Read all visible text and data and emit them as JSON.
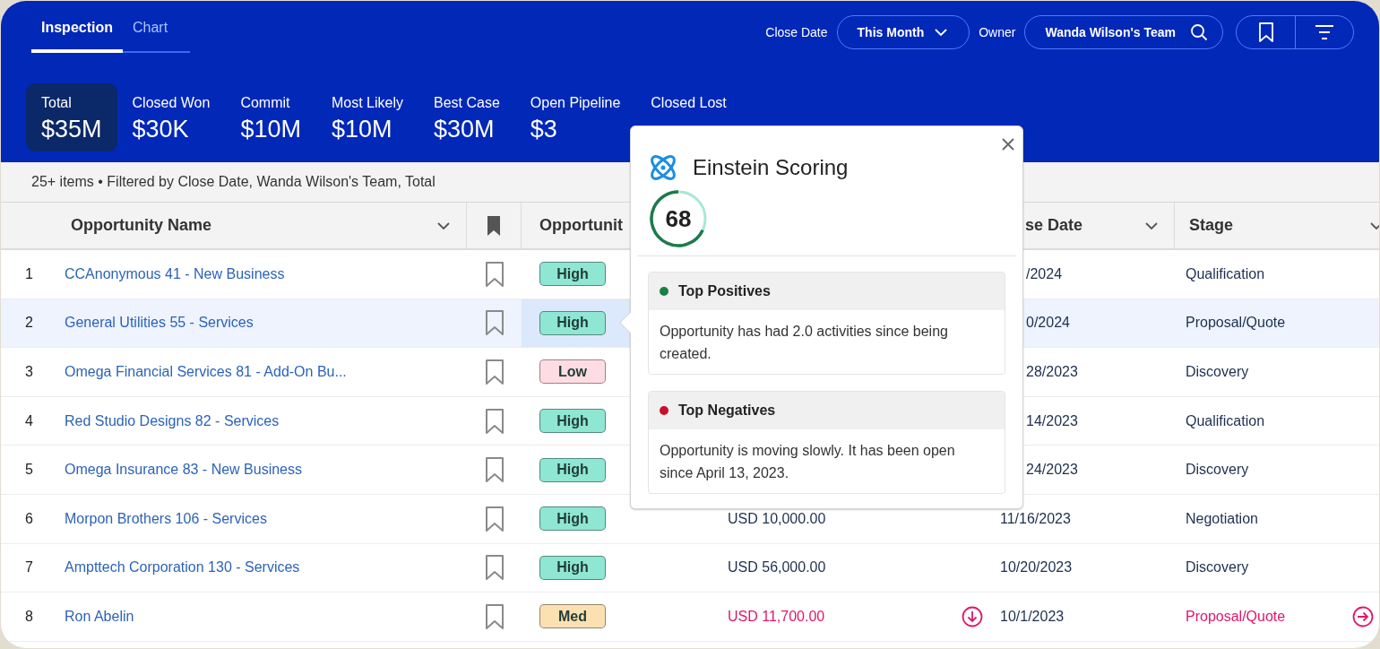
{
  "tabs": [
    {
      "label": "Inspection",
      "selected": true
    },
    {
      "label": "Chart",
      "selected": false
    }
  ],
  "filters": {
    "close_date_label": "Close Date",
    "close_date_value": "This Month",
    "owner_label": "Owner",
    "owner_value": "Wanda Wilson's Team"
  },
  "metrics": [
    {
      "label": "Total",
      "value": "$35M",
      "selected": true
    },
    {
      "label": "Closed Won",
      "value": "$30K",
      "selected": false
    },
    {
      "label": "Commit",
      "value": "$10M",
      "selected": false
    },
    {
      "label": "Most Likely",
      "value": "$10M",
      "selected": false
    },
    {
      "label": "Best Case",
      "value": "$30M",
      "selected": false
    },
    {
      "label": "Open Pipeline",
      "value": "$3",
      "selected": false
    },
    {
      "label": "Closed Lost",
      "selected": false
    }
  ],
  "filter_summary": "25+ items • Filtered by Close Date, Wanda Wilson's Team, Total",
  "table": {
    "columns": [
      "Opportunity Name",
      "Opportunit",
      "se Date",
      "Stage"
    ],
    "rows": [
      {
        "index": "1",
        "name": "CCAnonymous 41 - New Business",
        "score": "High",
        "color": "#8ee6d3",
        "date": "/2024",
        "stage": "Qualification",
        "selected": false,
        "flagged": false
      },
      {
        "index": "2",
        "name": "General Utilities 55 - Services",
        "score": "High",
        "color": "#8ee6d3",
        "date": "0/2024",
        "stage": "Proposal/Quote",
        "selected": true,
        "flagged": false
      },
      {
        "index": "3",
        "name": "Omega Financial Services 81 - Add-On Bu...",
        "score": "Low",
        "color": "#fddde3",
        "date": "28/2023",
        "stage": "Discovery",
        "selected": false,
        "flagged": false
      },
      {
        "index": "4",
        "name": "Red Studio Designs 82 - Services",
        "score": "High",
        "color": "#8ee6d3",
        "date": "14/2023",
        "stage": "Qualification",
        "selected": false,
        "flagged": false
      },
      {
        "index": "5",
        "name": "Omega Insurance 83 - New Business",
        "score": "High",
        "color": "#8ee6d3",
        "date": "24/2023",
        "stage": "Discovery",
        "selected": false,
        "flagged": false
      },
      {
        "index": "6",
        "name": "Morpon Brothers 106 - Services",
        "score": "High",
        "color": "#8ee6d3",
        "amount": "USD 10,000.00",
        "date": "11/16/2023",
        "stage": "Negotiation",
        "selected": false,
        "flagged": false
      },
      {
        "index": "7",
        "name": "Ampttech Corporation 130 - Services",
        "score": "High",
        "color": "#8ee6d3",
        "amount": "USD 56,000.00",
        "date": "10/20/2023",
        "stage": "Discovery",
        "selected": false,
        "flagged": false
      },
      {
        "index": "8",
        "name": "Ron Abelin",
        "score": "Med",
        "color": "#fbe0b2",
        "amount": "USD 11,700.00",
        "date": "10/1/2023",
        "stage": "Proposal/Quote",
        "selected": false,
        "flagged": true
      }
    ]
  },
  "popover": {
    "title": "Einstein Scoring",
    "score": "68",
    "level": 0.68,
    "sections": [
      {
        "title": "Top Positives",
        "color": "#1a7f45",
        "text": "Opportunity has had 2.0 activities since being created."
      },
      {
        "title": "Top Negatives",
        "color": "#c8102e",
        "text": "Opportunity is moving slowly. It has been open since April 13, 2023."
      }
    ]
  }
}
